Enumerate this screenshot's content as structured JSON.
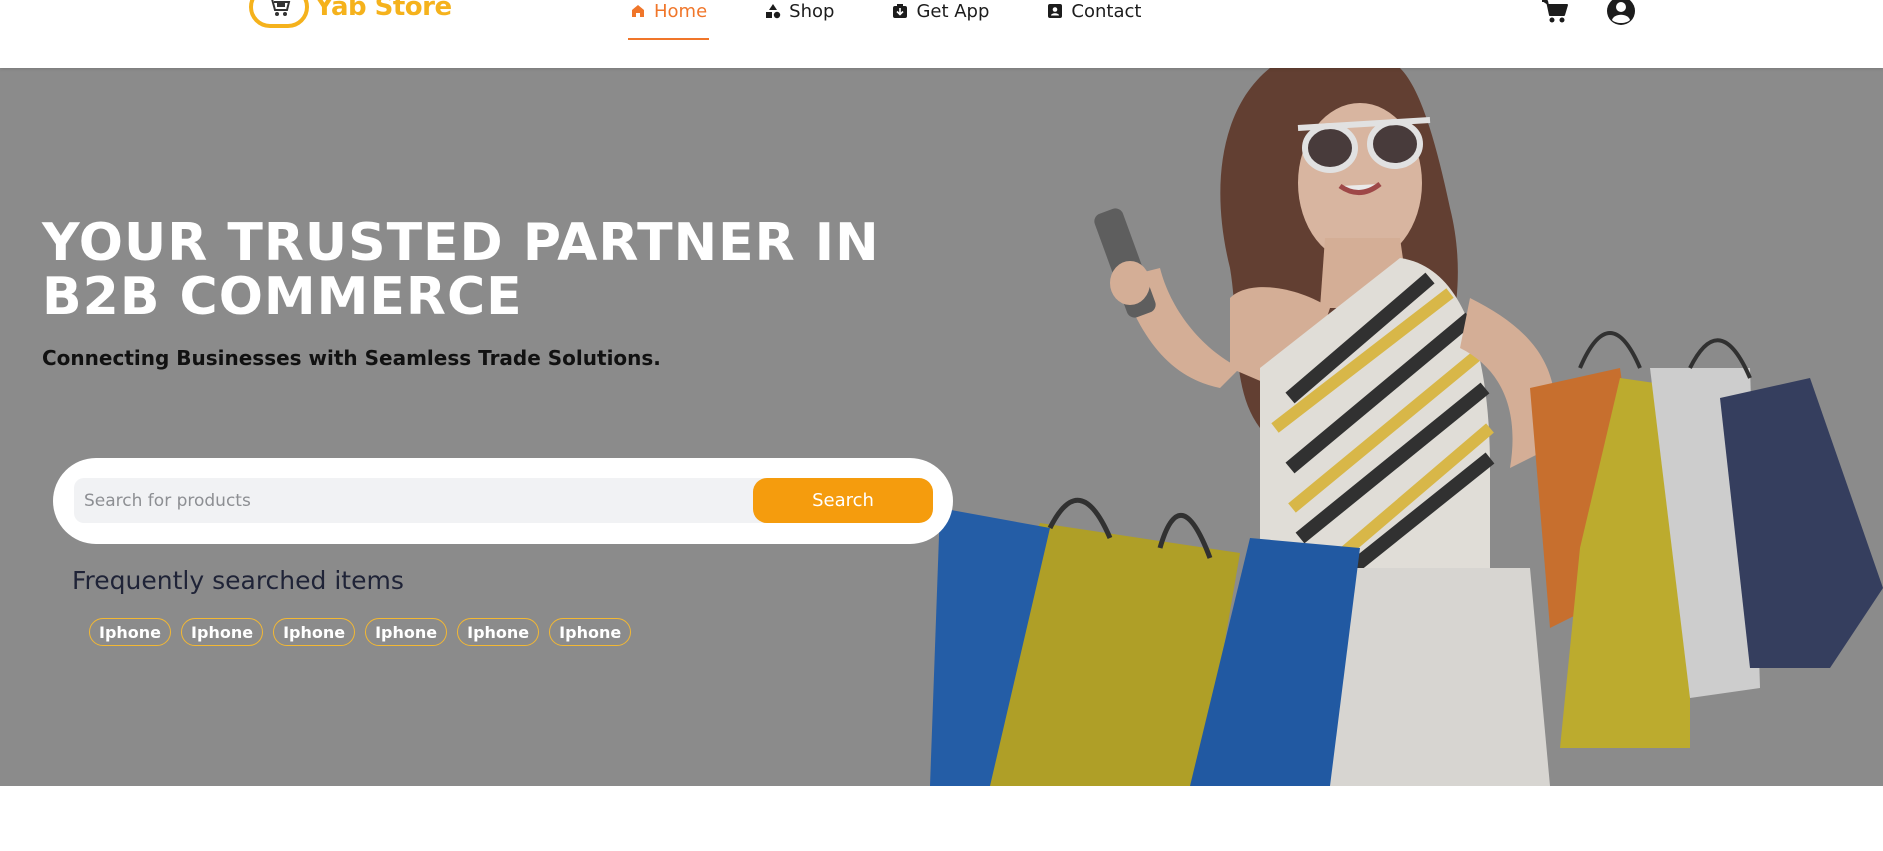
{
  "brand": {
    "name": "Yab Store",
    "color": "#f5b21c"
  },
  "nav": {
    "items": [
      {
        "label": "Home",
        "icon": "home-icon",
        "active": true
      },
      {
        "label": "Shop",
        "icon": "shapes-icon",
        "active": false
      },
      {
        "label": "Get App",
        "icon": "app-download-icon",
        "active": false
      },
      {
        "label": "Contact",
        "icon": "contact-card-icon",
        "active": false
      }
    ],
    "active_color": "#f0762a",
    "right_icons": [
      "cart-icon",
      "user-account-icon"
    ]
  },
  "hero": {
    "title": "YOUR TRUSTED PARTNER IN B2B COMMERCE",
    "subtitle": "Connecting Businesses with Seamless Trade Solutions.",
    "background_color": "#8b8b8b",
    "image": "woman-with-shopping-bags-photo"
  },
  "search": {
    "placeholder": "Search for products",
    "value": "",
    "button_label": "Search",
    "button_color": "#f59c0d"
  },
  "frequent": {
    "title": "Frequently searched items",
    "tags": [
      "Iphone",
      "Iphone",
      "Iphone",
      "Iphone",
      "Iphone",
      "Iphone"
    ],
    "tag_border_color": "#f3b833"
  }
}
